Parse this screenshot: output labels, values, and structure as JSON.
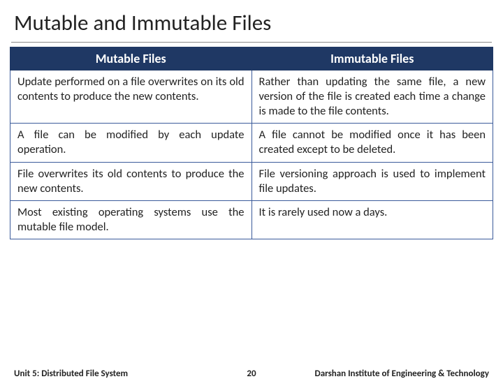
{
  "title": "Mutable and Immutable Files",
  "table": {
    "headers": [
      "Mutable Files",
      "Immutable Files"
    ],
    "rows": [
      {
        "left": "Update performed on a file overwrites on its old contents to produce the new contents.",
        "right": "Rather than updating the same file, a new version of the file is created each time a change is made to the file contents."
      },
      {
        "left": "A file can be modified by each update operation.",
        "right": "A file cannot be modified once it has been created except to be deleted."
      },
      {
        "left": "File overwrites its old contents to produce the new contents.",
        "right": "File versioning approach is used to implement file updates."
      },
      {
        "left": "Most existing operating systems use the mutable file model.",
        "right": "It is rarely used now a days."
      }
    ]
  },
  "footer": {
    "left": "Unit 5: Distributed File System",
    "center": "20",
    "right": "Darshan Institute of Engineering & Technology"
  }
}
